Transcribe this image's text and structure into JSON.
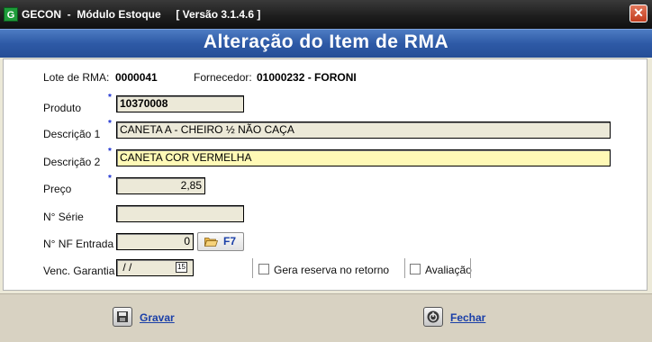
{
  "window": {
    "title": "GECON  -  Módulo Estoque     [ Versão 3.1.4.6 ]",
    "close_glyph": "✕",
    "app_icon_letter": "G"
  },
  "header": {
    "title": "Alteração do Item de RMA"
  },
  "info": {
    "lote_label": "Lote de RMA:",
    "lote_value": "0000041",
    "fornecedor_label": "Fornecedor:",
    "fornecedor_value": "01000232 - FORONI"
  },
  "fields": {
    "produto": {
      "label": "Produto",
      "value": "10370008",
      "required": "*"
    },
    "descricao1": {
      "label": "Descrição 1",
      "value": "CANETA A - CHEIRO ½ NÃO CAÇA",
      "required": "*"
    },
    "descricao2": {
      "label": "Descrição 2",
      "value": "CANETA COR VERMELHA",
      "required": "*"
    },
    "preco": {
      "label": "Preço",
      "value": "2,85",
      "required": "*"
    },
    "n_serie": {
      "label": "N° Série",
      "value": ""
    },
    "nf_entrada": {
      "label": "N° NF Entrada",
      "value": "0",
      "button_label": "F7"
    },
    "venc_garantia": {
      "label": "Venc. Garantia",
      "value": " / /",
      "calendar_glyph": "15"
    }
  },
  "checkboxes": {
    "gera_reserva": {
      "label": "Gera reserva no retorno",
      "checked": false
    },
    "avaliacao": {
      "label": "Avaliação",
      "checked": false
    }
  },
  "footer": {
    "gravar_label": "Gravar",
    "fechar_label": "Fechar"
  },
  "colors": {
    "header_blue": "#2e5aa6",
    "highlight_yellow": "#fff9b6",
    "button_text_blue": "#1a3fa8",
    "required_star": "#1a2fd0"
  }
}
